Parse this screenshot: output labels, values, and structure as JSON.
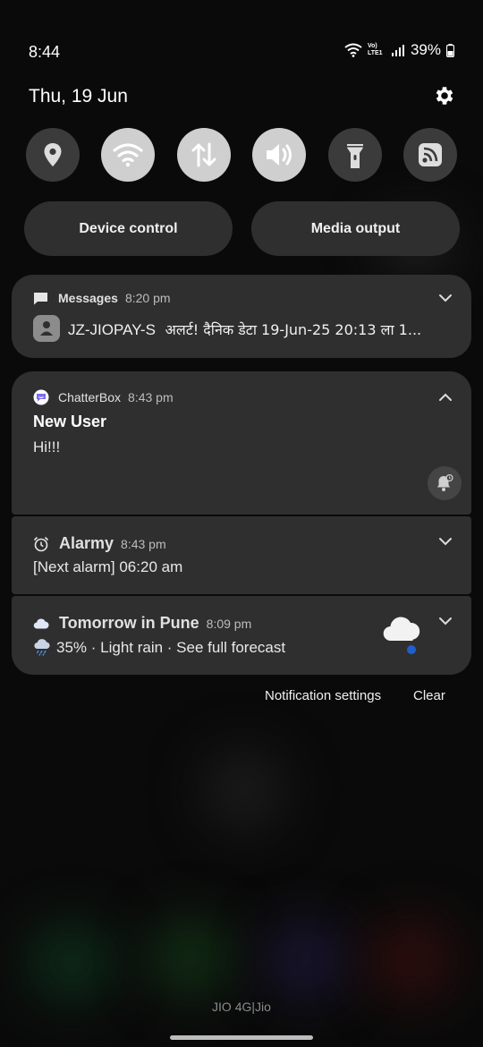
{
  "status_bar": {
    "time": "8:44",
    "signal_label": "Vo) LTE1",
    "battery_percent": "39%"
  },
  "header": {
    "date": "Thu, 19 Jun"
  },
  "quick_settings": {
    "tiles": [
      {
        "icon": "location-icon",
        "state": "off"
      },
      {
        "icon": "wifi-icon",
        "state": "on"
      },
      {
        "icon": "mobile-data-icon",
        "state": "on"
      },
      {
        "icon": "sound-icon",
        "state": "on"
      },
      {
        "icon": "flashlight-icon",
        "state": "off"
      },
      {
        "icon": "cast-icon",
        "state": "off"
      }
    ],
    "device_control_label": "Device control",
    "media_output_label": "Media output"
  },
  "notifications": {
    "messages": {
      "app": "Messages",
      "time": "8:20 pm",
      "sender": "JZ-JIOPAY-S",
      "preview": "अलर्ट! दैनिक डेटा 19-Jun-25 20:13 ला 1..."
    },
    "chatterbox": {
      "app": "ChatterBox",
      "time": "8:43 pm",
      "title": "New User",
      "body": "Hi!!!"
    },
    "alarmy": {
      "app": "Alarmy",
      "time": "8:43 pm",
      "body": "[Next alarm] 06:20 am"
    },
    "weather": {
      "app": "Tomorrow in Pune",
      "time": "8:09 pm",
      "body": "35% · Light rain · See full forecast"
    }
  },
  "footer": {
    "notification_settings_label": "Notification settings",
    "clear_label": "Clear",
    "carrier": "JIO 4G|Jio"
  },
  "colors": {
    "background": "#0a0a0a",
    "card": "#2f2f2f",
    "tile_on": "#cfcfcf",
    "tile_off": "#3b3b3b",
    "chatterbox_accent": "#7b6cf0",
    "weather_dot": "#1f5fcf"
  }
}
